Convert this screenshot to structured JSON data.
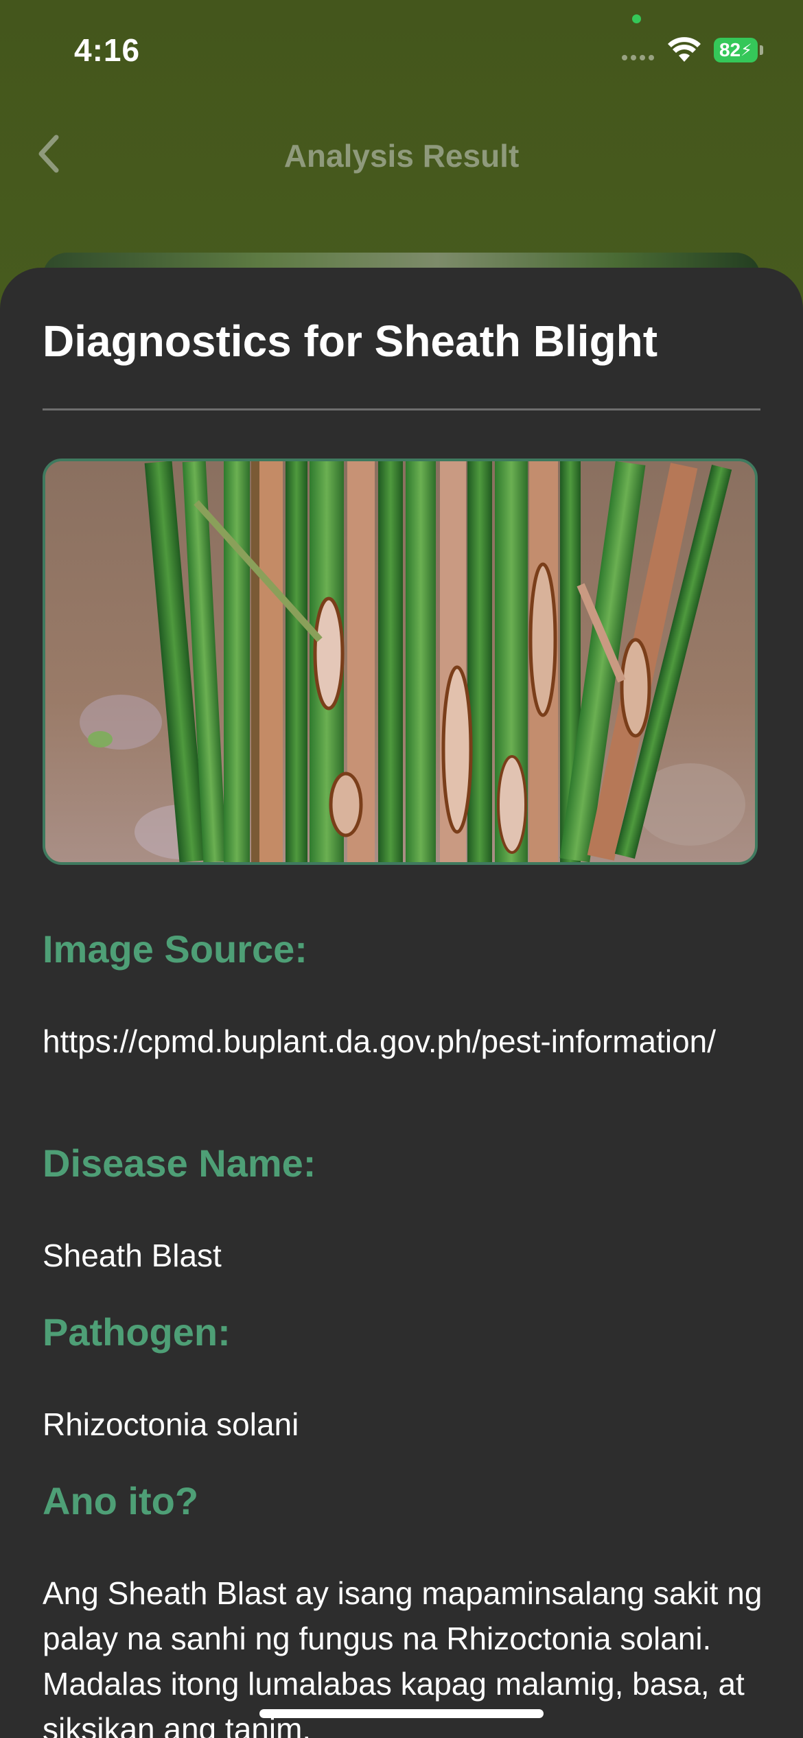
{
  "status_bar": {
    "time": "4:16",
    "battery_level": "82",
    "charging": true,
    "wifi": "full"
  },
  "nav": {
    "title": "Analysis Result",
    "back_icon": "chevron-left-icon"
  },
  "sheet": {
    "title": "Diagnostics for Sheath Blight",
    "image_alt": "rice sheath blight lesions on stems",
    "sections": [
      {
        "heading": "Image Source:",
        "text": "https://cpmd.buplant.da.gov.ph/pest-information/"
      },
      {
        "heading": "Disease Name:",
        "text": "Sheath Blast"
      },
      {
        "heading": "Pathogen:",
        "text": "Rhizoctonia solani"
      },
      {
        "heading": "Ano ito?",
        "text": "Ang Sheath Blast ay isang mapaminsalang sakit ng palay na sanhi ng fungus na Rhizoctonia solani. Madalas itong lumalabas kapag malamig, basa, at siksikan ang tanim."
      }
    ]
  },
  "colors": {
    "accent_green": "#4e9f76",
    "sheet_bg": "#2d2d2d",
    "battery_green": "#35c759"
  }
}
